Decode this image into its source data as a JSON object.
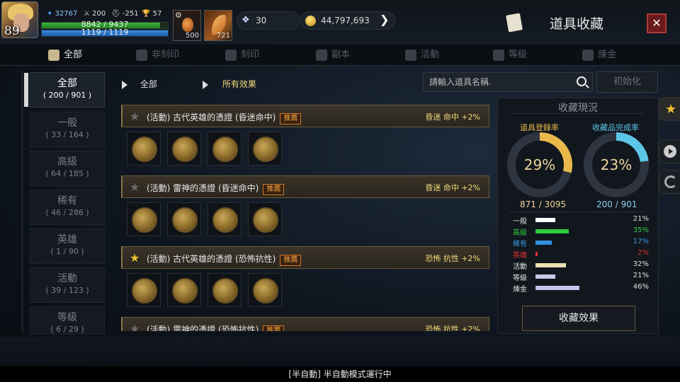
{
  "player": {
    "level": "89",
    "combat_power": "32767",
    "stat_attack": "200",
    "stat_defense": "-251",
    "stat_trophy": "57",
    "hp_text": "8842 / 9437",
    "mp_text": "1119 / 1119",
    "hp_fraction": 0.937,
    "mp_fraction": 1.0
  },
  "quick_slots": [
    {
      "icon": "potion-icon",
      "count": "500"
    },
    {
      "icon": "feather-icon",
      "count": "721"
    }
  ],
  "currency": {
    "energy": "30",
    "gold": "44,797,693"
  },
  "header": {
    "title": "道具收藏",
    "close_label": "✕"
  },
  "tabs": [
    {
      "label": "全部",
      "icon": "book-icon",
      "active": true
    },
    {
      "label": "非刻印",
      "icon": "shield-x-icon",
      "active": false
    },
    {
      "label": "刻印",
      "icon": "shield-icon",
      "active": false
    },
    {
      "label": "副本",
      "icon": "helmet-icon",
      "active": false
    },
    {
      "label": "活動",
      "icon": "gift-icon",
      "active": false
    },
    {
      "label": "等級",
      "icon": "lv-icon",
      "active": false
    },
    {
      "label": "煉金",
      "icon": "alchemy-icon",
      "active": false
    }
  ],
  "categories": [
    {
      "name": "全部",
      "count": "( 200 / 901 )",
      "active": true
    },
    {
      "name": "一般",
      "count": "( 33 / 164 )",
      "active": false
    },
    {
      "name": "高級",
      "count": "( 64 / 185 )",
      "active": false
    },
    {
      "name": "稀有",
      "count": "( 46 / 286 )",
      "active": false
    },
    {
      "name": "英雄",
      "count": "( 1 / 90 )",
      "active": false
    },
    {
      "name": "活動",
      "count": "( 39 / 123 )",
      "active": false
    },
    {
      "name": "等級",
      "count": "( 6 / 29 )",
      "active": false
    }
  ],
  "filters": {
    "filter1": "全部",
    "filter2": "所有效果",
    "search_placeholder": "請輸入道具名稱.",
    "reset_label": "初始化"
  },
  "collections": [
    {
      "title": "(活動) 古代英雄的憑證 (昏迷命中)",
      "tag": "推薦",
      "effect": "昏迷 命中 +2%",
      "starred": false
    },
    {
      "title": "(活動) 雷神的憑證 (昏迷命中)",
      "tag": "推薦",
      "effect": "昏迷 命中 +2%",
      "starred": false
    },
    {
      "title": "(活動) 古代英雄的憑證 (恐怖抗性)",
      "tag": "推薦",
      "effect": "恐怖 抗性 +2%",
      "starred": true
    },
    {
      "title": "(活動) 雷神的憑證 (恐怖抗性)",
      "tag": "推薦",
      "effect": "恐怖 抗性 +2%",
      "starred": false
    }
  ],
  "status_panel": {
    "title": "收藏現況",
    "reg_label": "道具登錄率",
    "reg_pct": "29%",
    "reg_value": 29,
    "reg_count": "871 / 3095",
    "complete_label": "收藏品完成率",
    "complete_pct": "23%",
    "complete_value": 23,
    "complete_count": "200 / 901",
    "reg_color": "#e8b84a",
    "complete_color": "#5cc6e8",
    "grades": [
      {
        "label": "一般",
        "pct": "21%",
        "value": 21,
        "color": "#ffffff",
        "text_color": "#e0e0e0"
      },
      {
        "label": "高級",
        "pct": "35%",
        "value": 35,
        "color": "#2ecc40",
        "text_color": "#2ecc40"
      },
      {
        "label": "稀有",
        "pct": "17%",
        "value": 17,
        "color": "#2f8fe0",
        "text_color": "#3a9ae8"
      },
      {
        "label": "英雄",
        "pct": "2%",
        "value": 2,
        "color": "#e03030",
        "text_color": "#e03030"
      },
      {
        "label": "活動",
        "pct": "32%",
        "value": 32,
        "color": "#ece0b0",
        "text_color": "#e0e0e0"
      },
      {
        "label": "等級",
        "pct": "21%",
        "value": 21,
        "color": "#c8c8e8",
        "text_color": "#e0e0e0"
      },
      {
        "label": "煉金",
        "pct": "46%",
        "value": 46,
        "color": "#c0c4e8",
        "text_color": "#e0e0e0"
      }
    ],
    "effect_button": "收藏效果"
  },
  "status_bar": "[半自動] 半自動模式運行中"
}
